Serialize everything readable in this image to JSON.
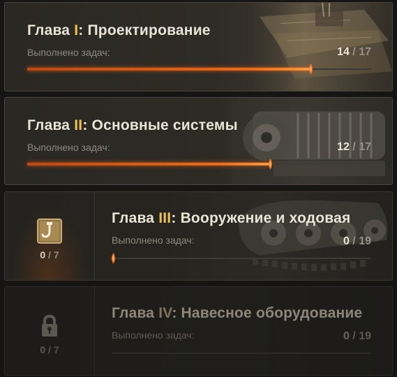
{
  "subtitle_label": "Выполнено задач:",
  "chapters": [
    {
      "prefix": "Глава ",
      "numeral": "I",
      "title": ": Проектирование",
      "done": "14",
      "sep": " / ",
      "total": "17",
      "progress": 0.8235,
      "state": "unlocked"
    },
    {
      "prefix": "Глава ",
      "numeral": "II",
      "title": ": Основные системы",
      "done": "12",
      "sep": " / ",
      "total": "17",
      "progress": 0.7059,
      "state": "unlocked"
    },
    {
      "prefix": "Глава ",
      "numeral": "III",
      "title": ": Вооружение и ходовая",
      "done": "0",
      "sep": " / ",
      "total": "19",
      "progress": 0.0,
      "state": "active",
      "reward_done": "0",
      "reward_sep": " / ",
      "reward_total": "7",
      "icon": "crane-hook-icon"
    },
    {
      "prefix": "Глава ",
      "numeral": "IV",
      "title": ": Навесное оборудование",
      "done": "0",
      "sep": " / ",
      "total": "19",
      "progress": 0.0,
      "state": "locked",
      "reward_done": "0",
      "reward_sep": " / ",
      "reward_total": "7",
      "icon": "lock-icon"
    }
  ],
  "colors": {
    "accent": "#f1c34d",
    "progress": "#f06a14",
    "text": "#e8e4d6",
    "muted": "#8d8a80"
  }
}
